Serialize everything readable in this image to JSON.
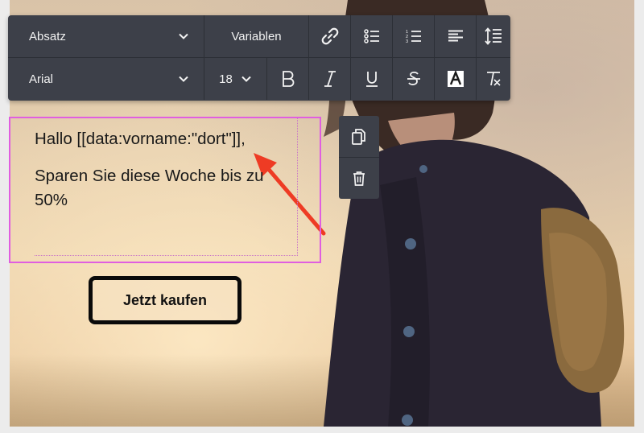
{
  "toolbar": {
    "paragraph_style": "Absatz",
    "variables_label": "Variablen",
    "font_family": "Arial",
    "font_size": "18",
    "buttons": {
      "link": "link-icon",
      "bullet_list": "bullet-list-icon",
      "numbered_list": "numbered-list-icon",
      "align": "align-left-icon",
      "line_height": "line-height-icon",
      "bold": "bold-icon",
      "italic": "italic-icon",
      "underline": "underline-icon",
      "strikethrough": "strikethrough-icon",
      "text_color": "text-color-icon",
      "clear_format": "clear-format-icon"
    }
  },
  "editor": {
    "line1": "Hallo [[data:vorname:\"dort\"]],",
    "line2": "Sparen Sie diese Woche bis zu 50%"
  },
  "side_tools": {
    "copy": "copy-icon",
    "delete": "trash-icon"
  },
  "cta": {
    "label": "Jetzt kaufen"
  },
  "colors": {
    "toolbar_bg": "#3d4049",
    "selection_border": "#e05ee0",
    "arrow": "#ee3b24"
  }
}
